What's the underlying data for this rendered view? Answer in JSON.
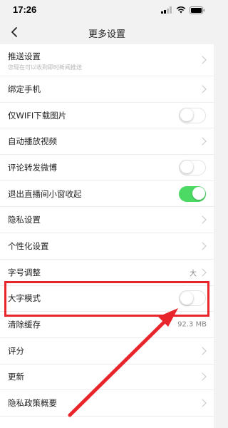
{
  "status_bar": {
    "time": "17:26"
  },
  "nav": {
    "title": "更多设置",
    "back_icon": "chevron-left-icon"
  },
  "settings": [
    {
      "label": "推送设置",
      "subtitle": "您现在可以收到即时新闻推送",
      "control": "chevron"
    },
    {
      "label": "绑定手机",
      "control": "chevron"
    },
    {
      "label": "仅WIFI下载图片",
      "control": "toggle",
      "on": false
    },
    {
      "label": "自动播放视频",
      "control": "chevron"
    },
    {
      "label": "评论转发微博",
      "control": "toggle",
      "on": false
    },
    {
      "label": "退出直播间小窗收起",
      "control": "toggle",
      "on": true
    },
    {
      "label": "隐私设置",
      "control": "chevron"
    },
    {
      "label": "个性化设置",
      "control": "chevron"
    },
    {
      "label": "字号调整",
      "value": "大",
      "control": "chevron"
    },
    {
      "label": "大字模式",
      "control": "toggle",
      "on": false
    },
    {
      "label": "清除缓存",
      "value": "92.3 MB",
      "control": "none"
    },
    {
      "label": "评分",
      "control": "chevron"
    },
    {
      "label": "更新",
      "control": "chevron"
    },
    {
      "label": "隐私政策概要",
      "control": "chevron"
    }
  ],
  "colors": {
    "toggle_on": "#4cd964",
    "annotation": "#e8252a",
    "background": "#f2f2f2"
  },
  "annotation": {
    "highlighted_item": "大字模式",
    "type": "red-box-and-arrow"
  }
}
